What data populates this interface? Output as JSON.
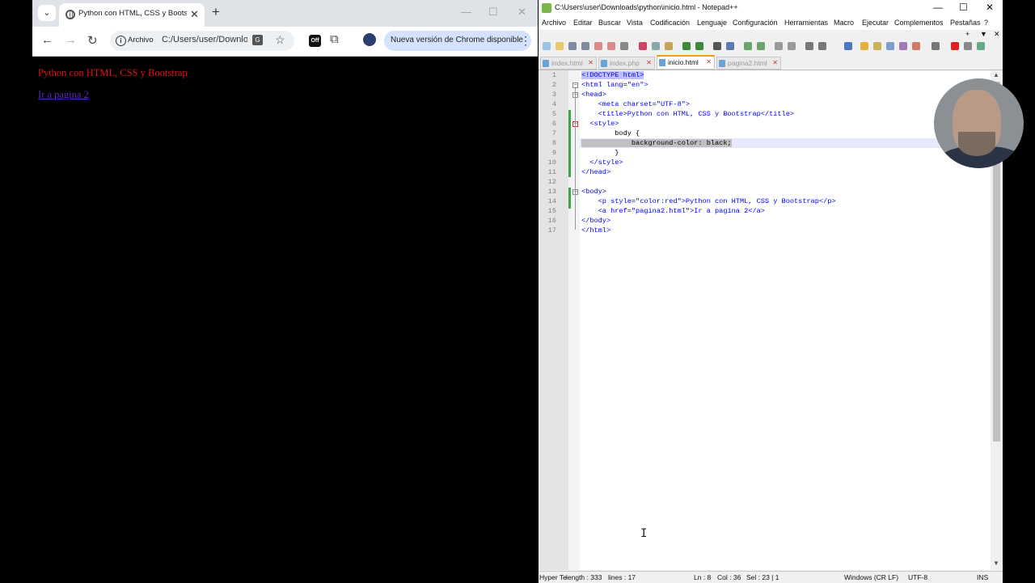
{
  "chrome": {
    "tab_title": "Python con HTML, CSS y Bootstrap",
    "tab_close": "✕",
    "new_tab": "+",
    "tab_menu": "⌄",
    "window_minimize": "—",
    "window_maximize": "☐",
    "window_close": "✕",
    "nav_back": "←",
    "nav_forward": "→",
    "nav_reload": "↻",
    "omnibox_chip": "Archivo",
    "url": "C:/Users/user/Downloads/python/inicio.html",
    "ext_off_label": "Off",
    "update_text": "Nueva versión de Chrome disponible",
    "page": {
      "paragraph": "Python con HTML, CSS y Bootstrap",
      "link": "Ir a pagina 2"
    }
  },
  "npp": {
    "title": "C:\\Users\\user\\Downloads\\python\\inicio.html - Notepad++",
    "window_minimize": "—",
    "window_maximize": "☐",
    "window_close": "✕",
    "menu": [
      "Archivo",
      "Editar",
      "Buscar",
      "Vista",
      "Codificación",
      "Lenguaje",
      "Configuración",
      "Herramientas",
      "Macro",
      "Ejecutar",
      "Complementos",
      "Pestañas",
      "?"
    ],
    "menu_extra": [
      "+",
      "▼",
      "✕"
    ],
    "tabs": [
      {
        "label": "index.html",
        "active": false
      },
      {
        "label": "index.php",
        "active": false
      },
      {
        "label": "inicio.html",
        "active": true
      },
      {
        "label": "pagina2.html",
        "active": false
      }
    ],
    "line_numbers": [
      "1",
      "2",
      "3",
      "4",
      "5",
      "6",
      "7",
      "8",
      "9",
      "10",
      "11",
      "12",
      "13",
      "14",
      "15",
      "16",
      "17"
    ],
    "code": [
      "<!DOCTYPE html>",
      "<html lang=\"en\">",
      "<head>",
      "    <meta charset=\"UTF-8\">",
      "    <title>Python con HTML, CSS y Bootstrap</title>",
      "  <style>",
      "        body {",
      "            background-color: black;",
      "        }",
      "  </style>",
      "</head>",
      "",
      "<body>",
      "    <p style=\"color:red\">Python con HTML, CSS y Bootstrap</p>",
      "    <a href=\"pagina2.html\">Ir a pagina 2</a>",
      "</body>",
      "</html>"
    ],
    "status": {
      "type": "Hyper Te",
      "length": "length : 333",
      "lines": "lines : 17",
      "ln": "Ln : 8",
      "col": "Col : 36",
      "sel": "Sel : 23 | 1",
      "eol": "Windows (CR LF)",
      "encoding": "UTF-8",
      "mode": "INS"
    }
  },
  "colors": {
    "page_bg": "#000000",
    "page_text_red": "#e0141a",
    "page_link": "#5b2ab5",
    "npp_keyword": "#0000ff",
    "npp_attr": "#ff0000",
    "npp_string": "#8000ff",
    "update_pill": "#d3e3fd"
  }
}
